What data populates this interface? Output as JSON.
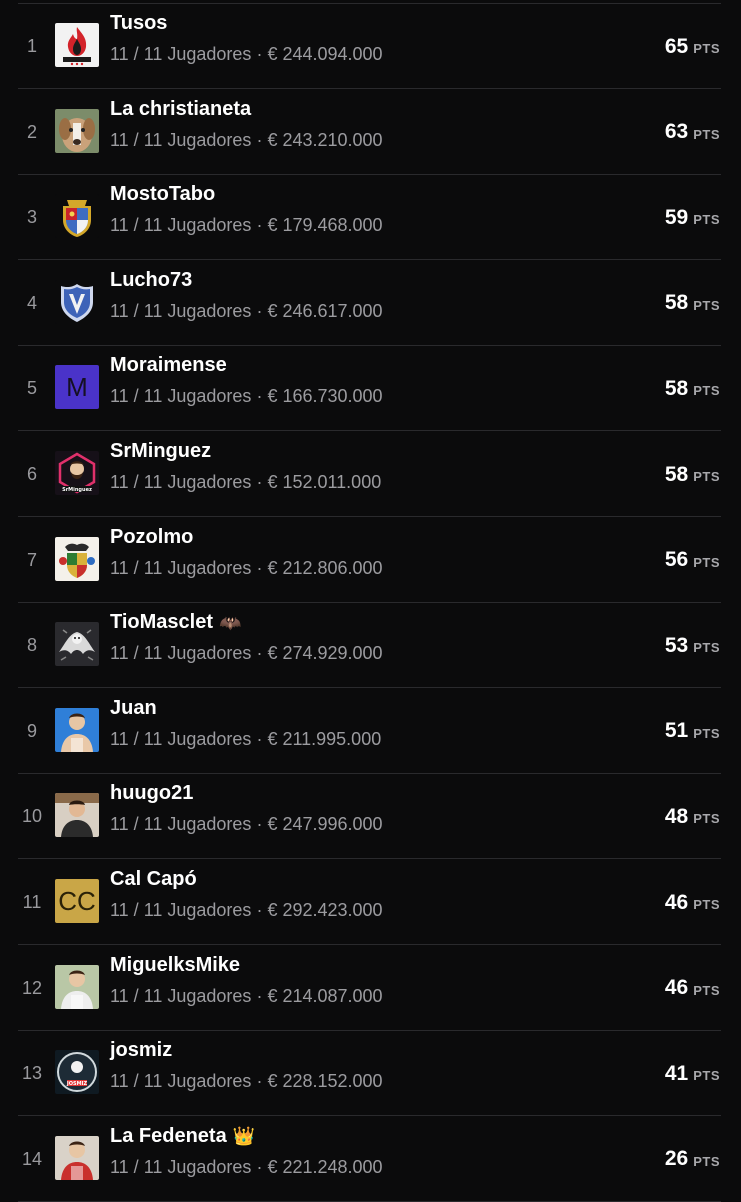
{
  "standings": [
    {
      "rank": "1",
      "name": "Tusos",
      "players": "11 / 11 Jugadores",
      "value": "€ 244.094.000",
      "points": "65",
      "unit": "PTS",
      "avatar": {
        "kind": "image",
        "icon": "flame-crest-icon",
        "bg": "#f2f2f2",
        "accent": "#d3232a"
      }
    },
    {
      "rank": "2",
      "name": "La christianeta",
      "players": "11 / 11 Jugadores",
      "value": "€ 243.210.000",
      "points": "63",
      "unit": "PTS",
      "avatar": {
        "kind": "image",
        "icon": "dog-photo-icon",
        "bg": "#caa27a",
        "accent": "#f3efe8"
      }
    },
    {
      "rank": "3",
      "name": "MostoTabo",
      "players": "11 / 11 Jugadores",
      "value": "€ 179.468.000",
      "points": "59",
      "unit": "PTS",
      "avatar": {
        "kind": "image",
        "icon": "coat-of-arms-icon",
        "bg": "#0b0b0c",
        "accent": "#c8232a"
      }
    },
    {
      "rank": "4",
      "name": "Lucho73",
      "players": "11 / 11 Jugadores",
      "value": "€ 246.617.000",
      "points": "58",
      "unit": "PTS",
      "avatar": {
        "kind": "image",
        "icon": "blue-shield-icon",
        "bg": "#0b0b0c",
        "accent": "#3e63b8"
      }
    },
    {
      "rank": "5",
      "name": "Moraimense",
      "players": "11 / 11 Jugadores",
      "value": "€ 166.730.000",
      "points": "58",
      "unit": "PTS",
      "avatar": {
        "kind": "letters",
        "letters": "M",
        "bg": "#4a33c9",
        "fg": "#151024"
      }
    },
    {
      "rank": "6",
      "name": "SrMinguez",
      "players": "11 / 11 Jugadores",
      "value": "€ 152.011.000",
      "points": "58",
      "unit": "PTS",
      "avatar": {
        "kind": "image",
        "icon": "neon-portrait-icon",
        "bg": "#161018",
        "accent": "#e0306b"
      }
    },
    {
      "rank": "7",
      "name": "Pozolmo",
      "players": "11 / 11 Jugadores",
      "value": "€ 212.806.000",
      "points": "56",
      "unit": "PTS",
      "avatar": {
        "kind": "image",
        "icon": "heraldic-crest-icon",
        "bg": "#f4f1ea",
        "accent": "#2e7d32"
      }
    },
    {
      "rank": "8",
      "name": "TioMasclet",
      "badge": "🦇",
      "players": "11 / 11 Jugadores",
      "value": "€ 274.929.000",
      "points": "53",
      "unit": "PTS",
      "avatar": {
        "kind": "image",
        "icon": "bat-emblem-icon",
        "bg": "#2a2a2e",
        "accent": "#d9d9d9"
      }
    },
    {
      "rank": "9",
      "name": "Juan",
      "players": "11 / 11 Jugadores",
      "value": "€ 211.995.000",
      "points": "51",
      "unit": "PTS",
      "avatar": {
        "kind": "image",
        "icon": "player-photo-icon",
        "bg": "#2f7fd8",
        "accent": "#e9c8a8"
      }
    },
    {
      "rank": "10",
      "name": "huugo21",
      "players": "11 / 11 Jugadores",
      "value": "€ 247.996.000",
      "points": "48",
      "unit": "PTS",
      "avatar": {
        "kind": "image",
        "icon": "person-photo-icon",
        "bg": "#d8cfc3",
        "accent": "#2b2b2b"
      }
    },
    {
      "rank": "11",
      "name": "Cal Capó",
      "players": "11 / 11 Jugadores",
      "value": "€ 292.423.000",
      "points": "46",
      "unit": "PTS",
      "avatar": {
        "kind": "letters",
        "letters": "CC",
        "bg": "#c9a647",
        "fg": "#2a2208"
      }
    },
    {
      "rank": "12",
      "name": "MiguelksMike",
      "players": "11 / 11 Jugadores",
      "value": "€ 214.087.000",
      "points": "46",
      "unit": "PTS",
      "avatar": {
        "kind": "image",
        "icon": "player-photo-icon",
        "bg": "#b9c7a6",
        "accent": "#eeeeee"
      }
    },
    {
      "rank": "13",
      "name": "josmiz",
      "players": "11 / 11 Jugadores",
      "value": "€ 228.152.000",
      "points": "41",
      "unit": "PTS",
      "avatar": {
        "kind": "image",
        "icon": "club-badge-icon",
        "bg": "#0f1a22",
        "accent": "#e03535"
      }
    },
    {
      "rank": "14",
      "name": "La Fedeneta",
      "badge": "👑",
      "players": "11 / 11 Jugadores",
      "value": "€ 221.248.000",
      "points": "26",
      "unit": "PTS",
      "avatar": {
        "kind": "image",
        "icon": "player-photo-icon",
        "bg": "#d9d2c8",
        "accent": "#c9302c"
      }
    }
  ]
}
